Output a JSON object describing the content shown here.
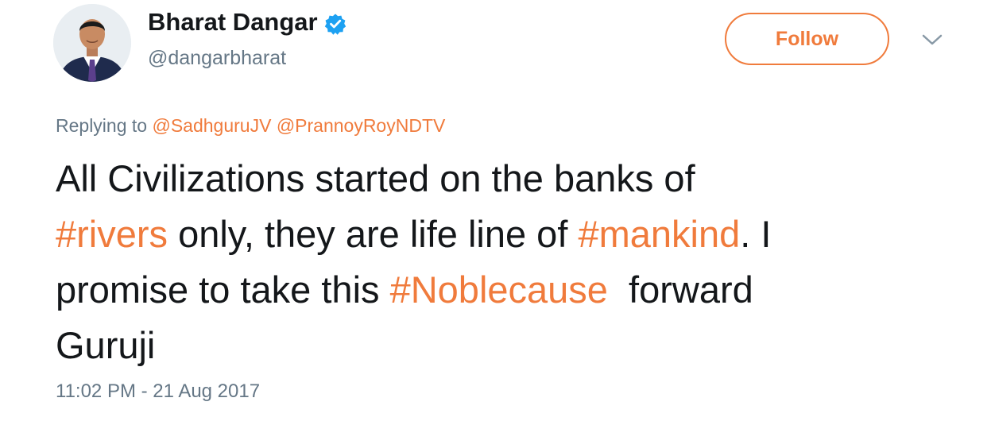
{
  "author": {
    "display_name": "Bharat Dangar",
    "handle": "@dangarbharat",
    "verified_icon": "verified-badge-icon",
    "avatar_icon": "profile-photo"
  },
  "follow_button": {
    "label": "Follow"
  },
  "menu_caret_icon": "chevron-down-icon",
  "reply": {
    "prefix": "Replying to",
    "mentions": [
      "@SadhguruJV",
      "@PrannoyRoyNDTV"
    ]
  },
  "tweet": {
    "line1": "All Civilizations started on the banks of",
    "line2_tag1": "#rivers",
    "line2_text": " only, they are life line of ",
    "line2_tag2": "#mankind",
    "line2_end": ". I",
    "line3_text": "promise to take this ",
    "line3_tag": "#Noblecause",
    "line3_end": "  forward",
    "line4": "Guruji"
  },
  "timestamp": "11:02 PM - 21 Aug 2017",
  "colors": {
    "accent": "#f07b3c",
    "text": "#14171a",
    "secondary": "#657786",
    "verified": "#1da1f2"
  }
}
